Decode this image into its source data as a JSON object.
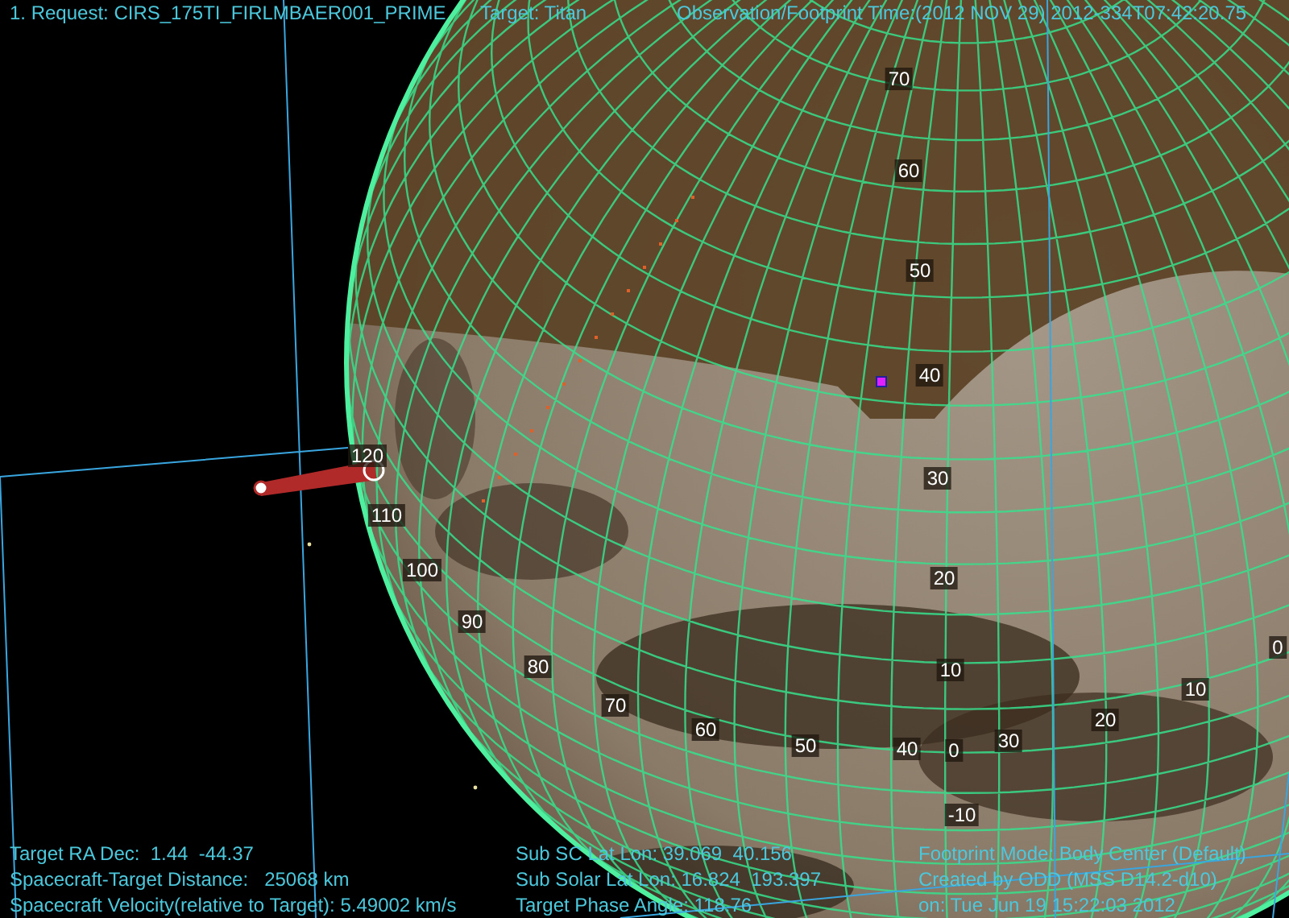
{
  "header": {
    "request": "1. Request: CIRS_175TI_FIRLMBAER001_PRIME",
    "target": "Target: Titan",
    "time": "Observation/Footprint Time:(2012 NOV 29) 2012-334T07:42:20.75"
  },
  "latitude_labels": [
    "70",
    "60",
    "50",
    "40",
    "30",
    "20",
    "10",
    "0",
    "-10"
  ],
  "longitude_labels": [
    "120",
    "110",
    "100",
    "90",
    "80",
    "70",
    "60",
    "50",
    "40",
    "30",
    "20",
    "10",
    "0"
  ],
  "info_left": [
    "Target RA Dec:  1.44  -44.37",
    "Spacecraft-Target Distance:   25068 km",
    "Spacecraft Velocity(relative to Target): 5.49002 km/s"
  ],
  "info_middle": [
    "Sub SC Lat Lon: 39.069  40.156",
    "Sub Solar Lat Lon: 16.824  193.397",
    "Target Phase Angle: 118.76"
  ],
  "info_right": [
    "Footprint Mode: Body Center (Default)",
    "Created by ODD (MSS D14.2-d10)",
    "on: Tue Jun 19 15:22:03 2012"
  ]
}
